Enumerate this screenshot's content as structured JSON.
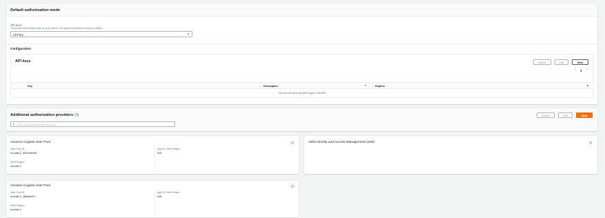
{
  "default_mode": {
    "title": "Default authorization mode",
    "api_level_label": "API level",
    "api_level_help": "The primary authorization mode for your schema. This applies to all fields and types by default.",
    "api_level_value": "API key",
    "configuration_label": "Configuration",
    "api_keys": {
      "title": "API keys",
      "delete_label": "Delete",
      "edit_label": "Edit",
      "new_label": "New",
      "page_number": "1",
      "columns": [
        "Key",
        "Description",
        "Expires"
      ],
      "empty_message": "You do not have any API Keys in this API."
    }
  },
  "additional": {
    "title": "Additional authorization providers",
    "count": "(3)",
    "delete_label": "Delete",
    "edit_label": "Edit",
    "new_label": "New",
    "search_placeholder": "Filter additional authorization providers",
    "providers": [
      {
        "title": "Amazon Cognito User Pool",
        "user_pool_id_label": "User Pool ID",
        "user_pool_id_value": "us-east-1_90VzxdenM",
        "app_id_label": "App ID Client Regex",
        "app_id_value": "N/A",
        "region_label": "AWS Region",
        "region_value": "us-east-1"
      },
      {
        "title": "AWS Identity and Access Management (IAM)"
      },
      {
        "title": "Amazon Cognito User Pool",
        "user_pool_id_label": "User Pool ID",
        "user_pool_id_value": "us-east-1_18p6yxeFL",
        "app_id_label": "App ID Client Regex",
        "app_id_value": "N/A",
        "region_label": "AWS Region",
        "region_value": "us-east-1"
      }
    ]
  },
  "colors": {
    "page_bg": "#f2f3f3",
    "primary_button": "#ec7211",
    "text": "#16191f",
    "muted_text": "#687078"
  }
}
